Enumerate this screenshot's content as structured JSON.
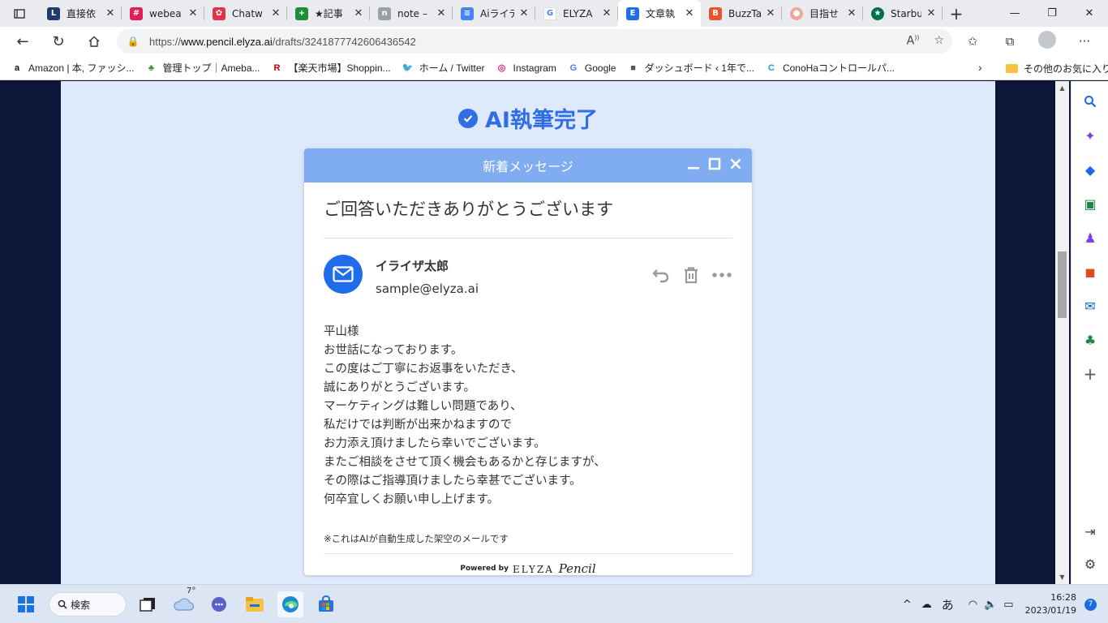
{
  "browser": {
    "tabs": [
      {
        "label": "直接依",
        "icon_color": "#203a6b",
        "glyph": "L"
      },
      {
        "label": "webea",
        "icon_color": "#e01e5a",
        "glyph": "#"
      },
      {
        "label": "Chatw",
        "icon_color": "#e0334c",
        "glyph": "✿"
      },
      {
        "label": "★記事",
        "icon_color": "#1e8e3e",
        "glyph": "+"
      },
      {
        "label": "note –",
        "icon_color": "#9aa0a6",
        "glyph": "n"
      },
      {
        "label": "Aiライテ",
        "icon_color": "#4285f4",
        "glyph": "≡"
      },
      {
        "label": "ELYZA",
        "icon_color": "#ffffff",
        "glyph": "G"
      },
      {
        "label": "文章執",
        "icon_color": "#1f6de8",
        "glyph": "E"
      },
      {
        "label": "BuzzTa",
        "icon_color": "#e8542c",
        "glyph": "B"
      },
      {
        "label": "目指せ",
        "icon_color": "#f2a49a",
        "glyph": "●"
      },
      {
        "label": "Starbu",
        "icon_color": "#00704a",
        "glyph": "★"
      }
    ],
    "url_prefix": "https://",
    "url_domain": "www.pencil.elyza.ai",
    "url_path": "/drafts/3241877742606436542",
    "bookmarks": [
      {
        "label": "Amazon | 本, ファッシ...",
        "glyph": "a",
        "color": "#111111"
      },
      {
        "label": "管理トップ｜Ameba...",
        "glyph": "♣",
        "color": "#3a8e2e"
      },
      {
        "label": "【楽天市場】Shoppin...",
        "glyph": "R",
        "color": "#bf0000"
      },
      {
        "label": "ホーム / Twitter",
        "glyph": "🐦",
        "color": "#1d9bf0"
      },
      {
        "label": "Instagram",
        "glyph": "◎",
        "color": "#d62976"
      },
      {
        "label": "Google",
        "glyph": "G",
        "color": "#4285f4"
      },
      {
        "label": "ダッシュボード ‹ 1年で...",
        "glyph": "■",
        "color": "#555555"
      },
      {
        "label": "ConoHaコントロールパ...",
        "glyph": "C",
        "color": "#1aa1d6"
      }
    ],
    "other_favorites": "その他のお気に入り"
  },
  "page": {
    "done_title": "AI執筆完了",
    "mail_header": "新着メッセージ",
    "subject": "ご回答いただきありがとうございます",
    "sender_name": "イライザ太郎",
    "sender_email": "sample@elyza.ai",
    "body_lines": [
      "平山様",
      "お世話になっております。",
      "この度はご丁寧にお返事をいただき、",
      "誠にありがとうございます。",
      "マーケティングは難しい問題であり、",
      "私だけでは判断が出来かねますので",
      "お力添え頂けましたら幸いでございます。",
      "またご相談をさせて頂く機会もあるかと存じますが、",
      "その際はご指導頂けましたら幸甚でございます。",
      "何卒宜しくお願い申し上げます。"
    ],
    "note": "※これはAIが自動生成した架空のメールです",
    "powered_by": "Powered by",
    "brand_name": "ELYZA",
    "brand_product": "Pencil"
  },
  "taskbar": {
    "search_label": "検索",
    "weather_temp": "7°",
    "ime": "あ",
    "time": "16:28",
    "date": "2023/01/19",
    "notification_count": "7"
  },
  "colors": {
    "accent": "#2f6ee6",
    "mail_header": "#80acf2",
    "page_background": "#dfe9fc",
    "outer_background": "#0b1638"
  }
}
